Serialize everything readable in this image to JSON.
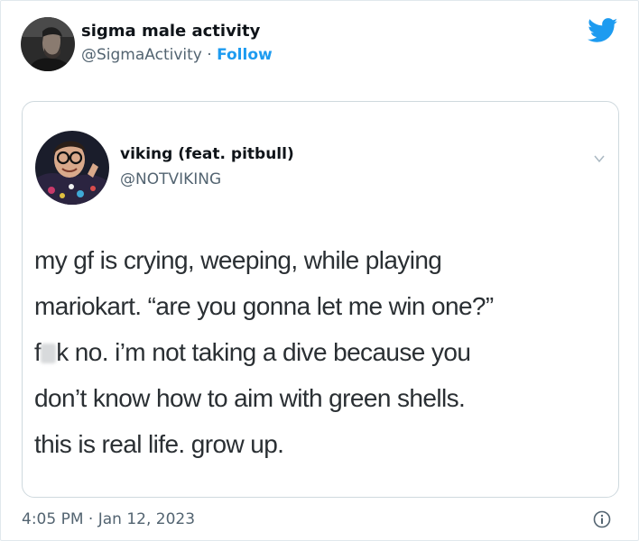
{
  "tweet": {
    "author_name": "sigma male activity",
    "author_handle": "@SigmaActivity",
    "separator": "·",
    "follow_label": "Follow",
    "timestamp": "4:05 PM · Jan 12, 2023"
  },
  "quoted": {
    "author_name": "viking (feat. pitbull)",
    "author_handle": "@NOTVIKING",
    "lines": [
      "my gf is crying, weeping, while playing",
      "mariokart. “are you gonna let me win one?”",
      "k no. i’m not taking a dive because you",
      "don’t know how to aim with green shells.",
      "this is real life. grow up."
    ],
    "line3_prefix": "f"
  },
  "colors": {
    "accent": "#1d9bf0",
    "secondary_text": "#536471",
    "border": "#cfd9de"
  },
  "icons": {
    "brand": "twitter-bird-icon",
    "menu": "chevron-down-icon",
    "info": "info-icon"
  }
}
